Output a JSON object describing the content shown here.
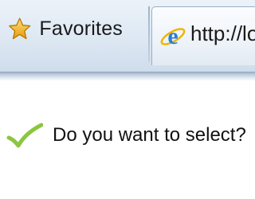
{
  "toolbar": {
    "favorites_label": "Favorites",
    "favorites_icon": "star-icon",
    "tab": {
      "url_text": "http://lo",
      "icon": "internet-explorer-icon"
    }
  },
  "content": {
    "check_icon": "checkmark-icon",
    "question": "Do you want to select?"
  },
  "colors": {
    "toolbar_bg": "#dde8f3",
    "star": "#f5b320",
    "ie_blue": "#2a7fd4",
    "check_green": "#8cc63f"
  }
}
